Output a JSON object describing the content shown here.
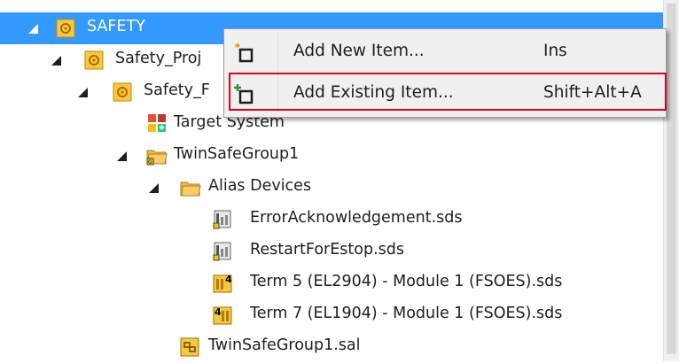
{
  "tree": {
    "items": [
      {
        "label": "SAFETY"
      },
      {
        "label": "Safety_Proj"
      },
      {
        "label": "Safety_F"
      },
      {
        "label": "Target System"
      },
      {
        "label": "TwinSafeGroup1"
      },
      {
        "label": "Alias Devices"
      },
      {
        "label": "ErrorAcknowledgement.sds"
      },
      {
        "label": "RestartForEstop.sds"
      },
      {
        "label": "Term 5 (EL2904) - Module 1 (FSOES).sds"
      },
      {
        "label": "Term 7 (EL1904) - Module 1 (FSOES).sds"
      },
      {
        "label": "TwinSafeGroup1.sal"
      }
    ]
  },
  "context_menu": {
    "items": [
      {
        "label": "Add New Item...",
        "shortcut": "Ins"
      },
      {
        "label": "Add Existing Item...",
        "shortcut": "Shift+Alt+A"
      }
    ]
  },
  "colors": {
    "selection": "#3399ff",
    "highlight_border": "#e1001a",
    "folder": "#f2b84b"
  }
}
